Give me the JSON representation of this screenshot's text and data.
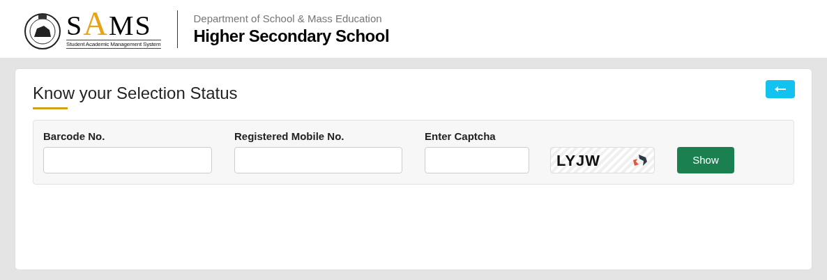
{
  "header": {
    "logo": {
      "letters": [
        "S",
        "A",
        "M",
        "S"
      ],
      "subtitle": "Student Academic Management System"
    },
    "department": "Department of School & Mass Education",
    "title": "Higher Secondary School"
  },
  "page": {
    "heading": "Know your Selection Status"
  },
  "form": {
    "fields": [
      {
        "label": "Barcode No."
      },
      {
        "label": "Registered Mobile No."
      },
      {
        "label": "Enter Captcha"
      }
    ],
    "captcha": {
      "text": "LYJW"
    },
    "submit": "Show"
  }
}
